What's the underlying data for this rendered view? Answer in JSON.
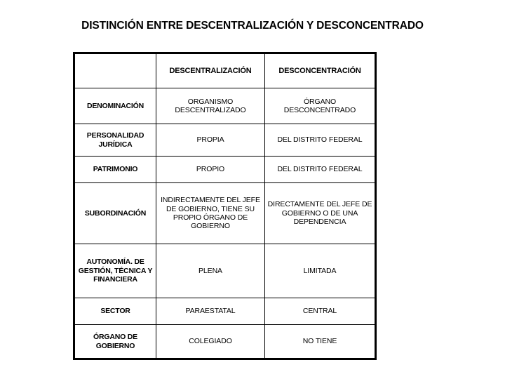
{
  "title": "DISTINCIÓN ENTRE DESCENTRALIZACIÓN Y DESCONCENTRADO",
  "table": {
    "columns": [
      "",
      "DESCENTRALIZACIÓN",
      "DESCONCENTRACIÓN"
    ],
    "rows": [
      {
        "label": "DENOMINACIÓN",
        "descentralizacion": "ORGANISMO DESCENTRALIZADO",
        "desconcentracion": "ÓRGANO DESCONCENTRADO"
      },
      {
        "label": "PERSONALIDAD JURÍDICA",
        "descentralizacion": "PROPIA",
        "desconcentracion": "DEL DISTRITO FEDERAL"
      },
      {
        "label": "PATRIMONIO",
        "descentralizacion": "PROPIO",
        "desconcentracion": "DEL DISTRITO FEDERAL"
      },
      {
        "label": "SUBORDINACIÓN",
        "descentralizacion": "INDIRECTAMENTE DEL JEFE DE GOBIERNO, TIENE SU PROPIO ÓRGANO DE GOBIERNO",
        "desconcentracion": "DIRECTAMENTE DEL JEFE DE GOBIERNO O DE UNA DEPENDENCIA"
      },
      {
        "label": "AUTONOMÍA. DE GESTIÓN, TÉCNICA Y FINANCIERA",
        "descentralizacion": "PLENA",
        "desconcentracion": "LIMITADA"
      },
      {
        "label": "SECTOR",
        "descentralizacion": "PARAESTATAL",
        "desconcentracion": "CENTRAL"
      },
      {
        "label": "ÓRGANO DE GOBIERNO",
        "descentralizacion": "COLEGIADO",
        "desconcentracion": "NO TIENE"
      }
    ]
  },
  "colors": {
    "background": "#ffffff",
    "text": "#000000",
    "border": "#000000"
  }
}
